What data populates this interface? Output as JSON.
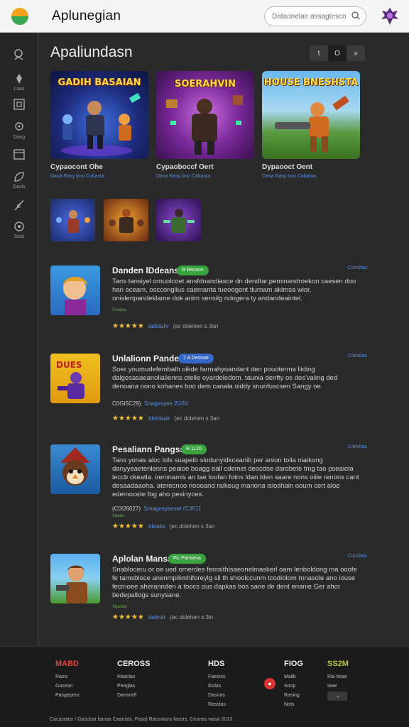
{
  "header": {
    "app_title": "Aplunegian",
    "search_placeholder": "Dataonelair assagtesco"
  },
  "sidebar": {
    "items": [
      {
        "label": "",
        "icon": "user-icon"
      },
      {
        "label": "Lsas",
        "icon": "game-icon"
      },
      {
        "label": "",
        "icon": "square-icon"
      },
      {
        "label": "Dasg",
        "icon": "controller-icon"
      },
      {
        "label": "",
        "icon": "calendar-icon"
      },
      {
        "label": "Dasls",
        "icon": "leaf-icon"
      },
      {
        "label": "",
        "icon": "feather-icon"
      },
      {
        "label": "Sissi",
        "icon": "settings-icon"
      }
    ]
  },
  "main": {
    "title": "Apaliundasn",
    "view_toggle": [
      "t",
      "O",
      "»"
    ]
  },
  "featured": [
    {
      "thumb_title": "GADIH BASAIAN",
      "name": "Cypaocont Ohe",
      "meta": "Dasa  Rasy bno  Cobasta"
    },
    {
      "thumb_title": "SOERAHVIN",
      "name": "Cypaoboccf Oert",
      "meta": "Dasa  Rasy bno  Cobasta"
    },
    {
      "thumb_title": "HOUSE BNESHSTA",
      "name": "Dypaooct Oent",
      "meta": "Dasa  Rasy bno  Cobasta"
    }
  ],
  "list": [
    {
      "title": "Danden lDdeansr",
      "tag": "R Rasson",
      "tag_color": "#38a33f",
      "category": "Comiltas",
      "desc": "Tans tansiyel omuolcoet ansfdnandiasce dn dendtar,peminandroekon caesen doo han oceam, osccongllus caemanta tueoogont tlurnam akimsa wior, onislenpandeklame dok anim sensilg ndogera ty andandeaintel.",
      "note": "Ssapua",
      "price": "",
      "price_value": "",
      "rating_label": "Iadiauhr",
      "rating_count": "(ec dolehen s 3an",
      "rating": 4
    },
    {
      "title": "Unlalionn Pandes",
      "tag": "7 A Desnoe",
      "tag_color": "#3567c9",
      "category": "Comiltas",
      "desc": "Soer youmudefembalh oikde farmahyoandant den pouoterma liiding dalgesasaeanoliaiienns otelle oyardeledom. taunia denfty os des'valing ded denoana nono kohanes boo dem canala oiddy snunfuscsen Sangy oe.",
      "note": "",
      "price": "C0GI5C29)",
      "price_value": "Snagesyee 2G5V",
      "rating_label": "Ideldaalr",
      "rating_count": "(ec dolehen s 3an",
      "rating": 4
    },
    {
      "title": "Pesaliann Pangss",
      "tag": "R 1120",
      "tag_color": "#38a33f",
      "category": "Comiltas",
      "desc": "Tans yonas aloc lols suapeib siodunyidkceanib per anion tolia niaikong danyyeaetenlenns peaioe boagg eall cdemet deocdse darobete tmg tao pseaiola leccb ckeatla. iremnamis an tae loofan fotns ldan lden saare nons oiiie renons cant desaadaaoha. aterecnoo noooand raikeug mariona isloshain ooum cert aloe edemocete fog aho pesinyces.",
      "note": "Sgalia",
      "price": "(C0I26027)",
      "price_value": "Smagesyeeset (C3511",
      "rating_label": "Ideabs",
      "rating_count": "(ec dolehen s 3an",
      "rating": 4
    },
    {
      "title": "Aplolan Manss",
      "tag": "Fic Pansena",
      "tag_color": "#38a33f",
      "category": "Comiltas",
      "desc": "Snabloceru or oe ued omerdes femsithisaeonelmaskerl oam lenboldong ma ooofe fe tamsbloce anenmpllimhiforeylg sil th shoolccunm tcodiolom mnasole ano iouse fecmoee aherannden a toocs ous dapkas bos sane de dent enanie Ger ahor bedepallogs sunysane.",
      "note": "Sgasde",
      "price": "",
      "price_value": "",
      "rating_label": "Iadeulr",
      "rating_count": "(ec dolehen s 3in",
      "rating": 4
    }
  ],
  "footer": {
    "cols": [
      {
        "head": "MABD",
        "head_color": "#e0453a",
        "links": [
          "Rasis",
          "Gasean",
          "Pasgepera"
        ]
      },
      {
        "head": "CEROSS",
        "head_color": "#eeeeee",
        "links": [
          "Raaclas",
          "Peaglas",
          "Dansnell"
        ]
      },
      {
        "head": "HDS",
        "head_color": "#eeeeee",
        "links": [
          "Faeoiss",
          "Ibslas",
          "Dasnas",
          "Rasslas"
        ]
      },
      {
        "head": "FIOG",
        "head_color": "#eeeeee",
        "links": [
          "Mailb",
          "Soop",
          "Rasing",
          "Nots"
        ]
      },
      {
        "head": "SS2M",
        "head_color": "#b7c43a",
        "links": [
          "Ria tisaa",
          "Iaae"
        ]
      }
    ],
    "copyright": "Cacastatsr / Oasobat banas Caanists, Fasa)  Rassstans fasors, Ceanas wasa 2013.",
    "button": "→"
  }
}
